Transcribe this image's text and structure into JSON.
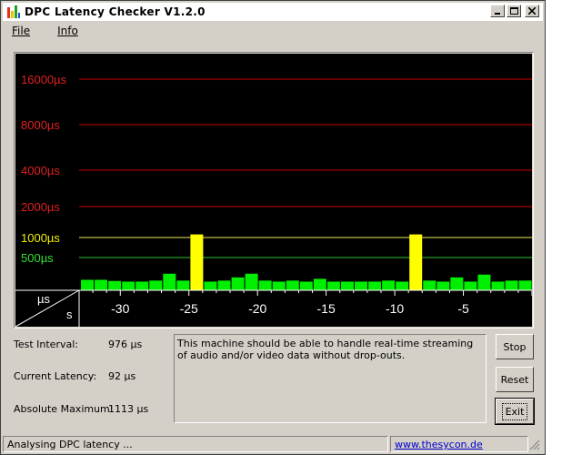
{
  "window": {
    "title": "DPC Latency Checker V1.2.0"
  },
  "menu": {
    "file": "File",
    "info": "Info"
  },
  "chart_data": {
    "type": "bar",
    "ylabel_unit": "µs",
    "xlabel_unit": "s",
    "y_levels": [
      {
        "label": "16000µs",
        "color": "#e02020",
        "line": "#cc0000"
      },
      {
        "label": "8000µs",
        "color": "#e02020",
        "line": "#cc0000"
      },
      {
        "label": "4000µs",
        "color": "#e02020",
        "line": "#cc0000"
      },
      {
        "label": "2000µs",
        "color": "#e02020",
        "line": "#cc0000"
      },
      {
        "label": "1000µs",
        "color": "#f0f000",
        "line": "#e8e85a"
      },
      {
        "label": "500µs",
        "color": "#30e030",
        "line": "#30c030"
      }
    ],
    "x_ticks": [
      "-30",
      "-25",
      "-20",
      "-15",
      "-10",
      "-5"
    ],
    "x_range": [
      -33,
      0
    ],
    "bar_colors": {
      "normal": "#00ee00",
      "warning": "#ffff00"
    },
    "values": [
      82,
      82,
      70,
      64,
      64,
      74,
      143,
      74,
      1113,
      64,
      74,
      106,
      143,
      74,
      64,
      74,
      64,
      92,
      64,
      64,
      64,
      64,
      74,
      64,
      1113,
      74,
      64,
      106,
      64,
      134,
      64,
      74,
      74
    ],
    "warning_indices": [
      8,
      24
    ]
  },
  "info": {
    "test_interval_label": "Test Interval:",
    "test_interval_value": "976 µs",
    "current_latency_label": "Current Latency:",
    "current_latency_value": "92 µs",
    "absolute_max_label": "Absolute Maximum:",
    "absolute_max_value": "1113 µs"
  },
  "message": "This machine should be able to handle real-time streaming of audio and/or video data without drop-outs.",
  "buttons": {
    "stop": "Stop",
    "reset": "Reset",
    "exit": "Exit"
  },
  "status": {
    "text": "Analysing DPC latency ...",
    "link": "www.thesycon.de"
  }
}
